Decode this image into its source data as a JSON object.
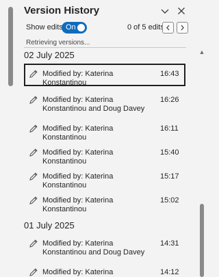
{
  "header": {
    "title": "Version History",
    "collapse_icon": "chevron-down-icon",
    "close_icon": "close-icon"
  },
  "toolbar": {
    "toggle_label": "Show edits",
    "toggle_state": "On",
    "counter": "0 of 5 edits",
    "prev_icon": "chevron-left-icon",
    "next_icon": "chevron-right-icon"
  },
  "status": "Retrieving versions...",
  "groups": [
    {
      "date": "02 July 2025",
      "entries": [
        {
          "text": "Modified by: Katerina Konstantinou",
          "time": "16:43",
          "selected": true
        },
        {
          "text": "Modified by: Katerina Konstantinou and Doug Davey",
          "time": "16:26"
        },
        {
          "text": "Modified by: Katerina Konstantinou",
          "time": "16:11"
        },
        {
          "text": "Modified by: Katerina Konstantinou",
          "time": "15:40"
        },
        {
          "text": "Modified by: Katerina Konstantinou",
          "time": "15:17"
        },
        {
          "text": "Modified by: Katerina Konstantinou",
          "time": "15:02"
        }
      ]
    },
    {
      "date": "01 July 2025",
      "entries": [
        {
          "text": "Modified by: Katerina Konstantinou and Doug Davey",
          "time": "14:31"
        },
        {
          "text": "Modified by: Katerina Konstantinou",
          "time": "14:12"
        }
      ]
    }
  ],
  "colors": {
    "accent": "#0f6cbd",
    "background": "#f3f3f3",
    "text": "#242424"
  }
}
